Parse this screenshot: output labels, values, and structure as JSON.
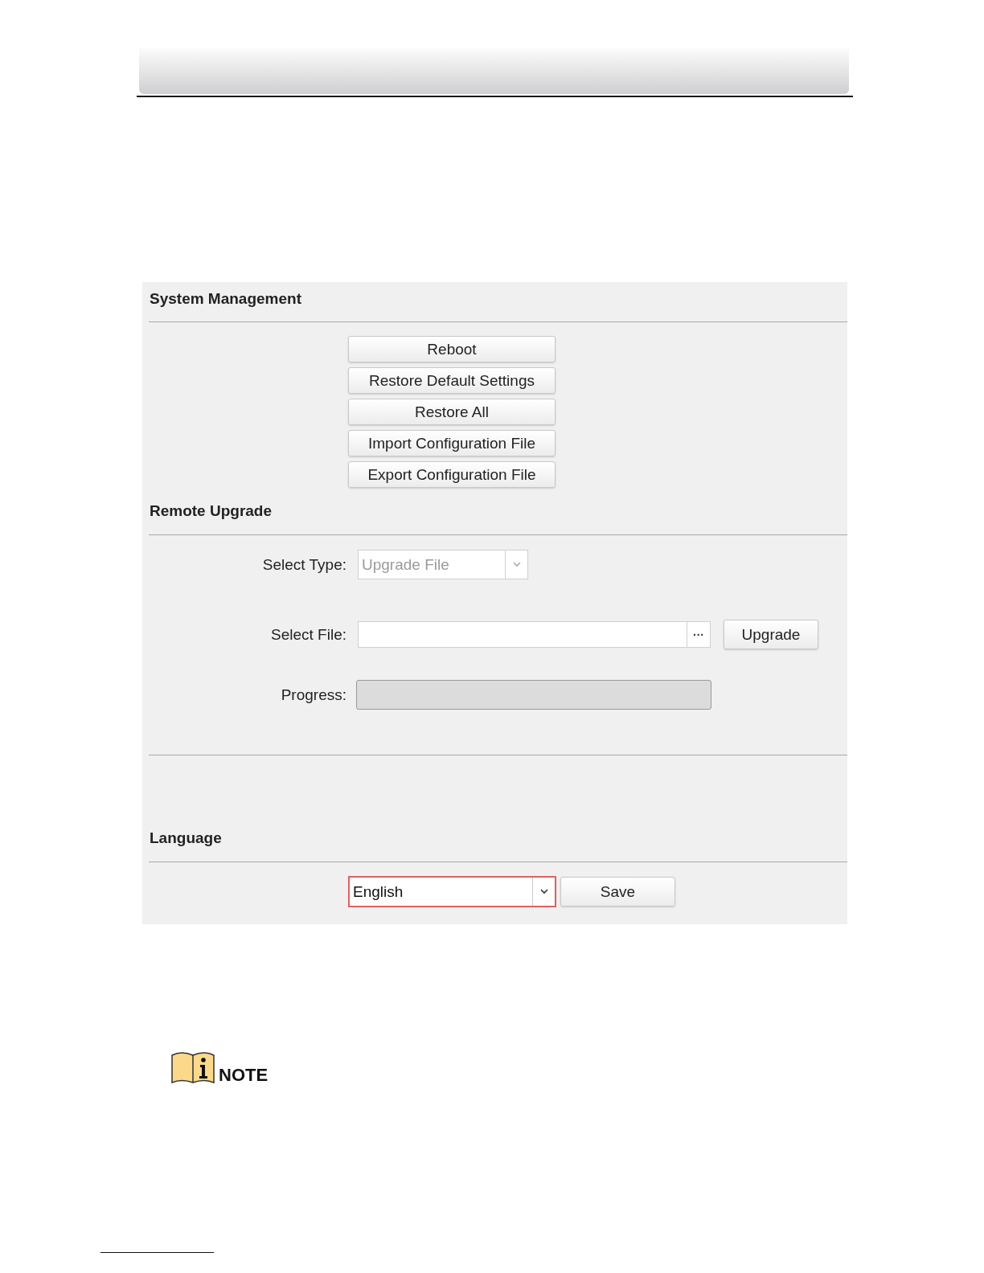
{
  "system_management": {
    "title": "System Management",
    "buttons": [
      "Reboot",
      "Restore Default Settings",
      "Restore All",
      "Import Configuration File",
      "Export Configuration File"
    ]
  },
  "remote_upgrade": {
    "title": "Remote Upgrade",
    "select_type": {
      "label": "Select Type:",
      "value": "Upgrade File",
      "disabled": true
    },
    "select_file": {
      "label": "Select File:",
      "browse": "···",
      "button": "Upgrade"
    },
    "progress": {
      "label": "Progress:",
      "level": 0
    }
  },
  "language": {
    "title": "Language",
    "value": "English",
    "focused": true,
    "button": "Save"
  },
  "note": {
    "label": "NOTE"
  }
}
